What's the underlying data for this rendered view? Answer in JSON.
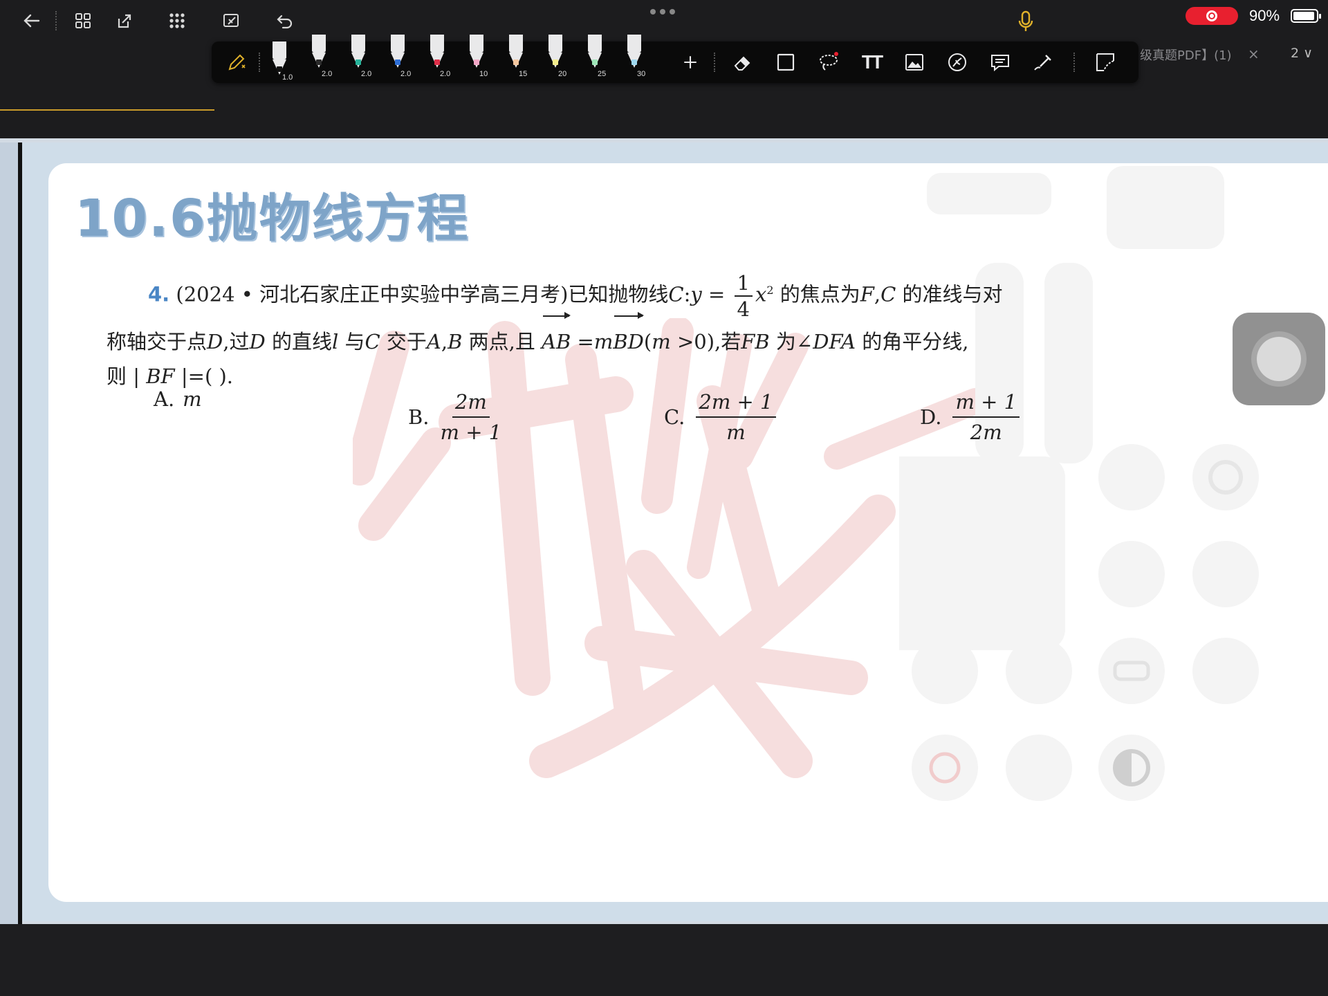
{
  "status": {
    "battery": "90%"
  },
  "tab": {
    "title_fragment": "级真题PDF】(1)",
    "close": "×",
    "page_number": "2",
    "page_chevron": "∨"
  },
  "pen_toolbar": {
    "pens": [
      {
        "size": "1.0",
        "color": "#111111"
      },
      {
        "size": "2.0",
        "color": "#2b2b2b"
      },
      {
        "size": "2.0",
        "color": "#27b39a"
      },
      {
        "size": "2.0",
        "color": "#2f6fd6"
      },
      {
        "size": "2.0",
        "color": "#e0304a"
      },
      {
        "size": "10",
        "color": "#f4a7c6"
      },
      {
        "size": "15",
        "color": "#f7c8a0"
      },
      {
        "size": "20",
        "color": "#f4ec8c"
      },
      {
        "size": "25",
        "color": "#9ee6b8"
      },
      {
        "size": "30",
        "color": "#9fd8f0"
      }
    ],
    "text_tool": "TT"
  },
  "document": {
    "title": "10.6抛物线方程",
    "question": {
      "number": "4.",
      "l1_a": "(2024 • 河北石家庄正中实验中学高三月考)已知抛物线",
      "l1_b": "C",
      "l1_c": ":",
      "l1_d": "y",
      "l1_e": " = ",
      "frac1_num": "1",
      "frac1_den": "4",
      "l1_f": "x",
      "l1_sup": "2",
      "l1_g": " 的焦点为",
      "l1_h": "F",
      "l1_i": ",",
      "l1_j": "C",
      "l1_k": " 的准线与对",
      "l2_a": "称轴交于点",
      "l2_b": "D",
      "l2_c": ",过",
      "l2_d": "D",
      "l2_e": " 的直线",
      "l2_f": "l",
      "l2_g": " 与",
      "l2_h": "C",
      "l2_i": " 交于",
      "l2_j": "A",
      "l2_k": ",",
      "l2_l": "B",
      "l2_m": " 两点,且 ",
      "l2_vec1": "AB",
      "l2_n": " =",
      "l2_o": "m",
      "l2_vec2": "BD",
      "l2_p": "(",
      "l2_q": "m",
      "l2_r": " >0),若",
      "l2_s": "FB",
      "l2_t": " 为∠",
      "l2_u": "DFA",
      "l2_v": " 的角平分线,",
      "l3_a": "则 | ",
      "l3_b": "BF",
      "l3_c": " |=(        )."
    },
    "options": [
      {
        "label": "A.",
        "content": "m"
      },
      {
        "label": "B.",
        "num": "2m",
        "den": "m + 1"
      },
      {
        "label": "C.",
        "num": "2m + 1",
        "den": "m"
      },
      {
        "label": "D.",
        "num": "m + 1",
        "den": "2m"
      }
    ]
  }
}
